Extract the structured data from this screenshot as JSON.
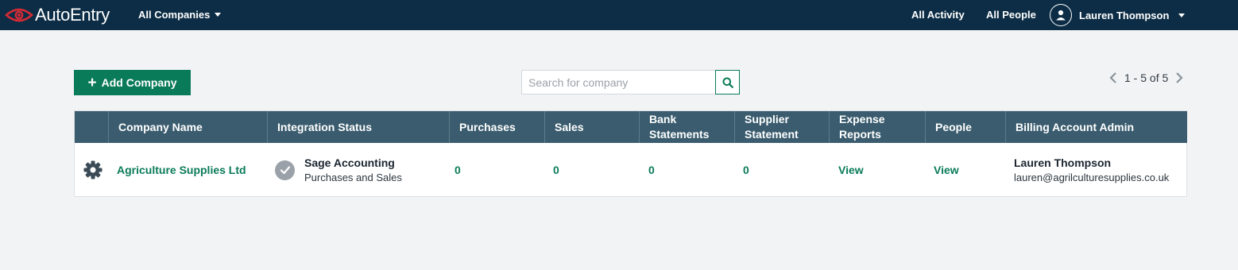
{
  "header": {
    "brand": "AutoEntry",
    "company_switch": "All Companies",
    "nav": {
      "activity": "All Activity",
      "people": "All People"
    },
    "user": {
      "name": "Lauren Thompson",
      "icon": "user-icon"
    }
  },
  "toolbar": {
    "add_company_label": "Add Company",
    "search_placeholder": "Search for company",
    "pagination": "1 - 5 of 5"
  },
  "table": {
    "columns": [
      "",
      "Company Name",
      "Integration Status",
      "Purchases",
      "Sales",
      "Bank Statements",
      "Supplier Statement",
      "Expense Reports",
      "People",
      "Billing Account Admin"
    ],
    "rows": [
      {
        "settings_icon": "gear-icon",
        "company_name": "Agriculture Supplies Ltd",
        "integration": {
          "title": "Sage Accounting",
          "subtitle": "Purchases and Sales",
          "icon": "check-circle-icon"
        },
        "purchases": "0",
        "sales": "0",
        "bank_statements": "0",
        "supplier_statement": "0",
        "expense_reports": "View",
        "people": "View",
        "billing_admin": {
          "name": "Lauren Thompson",
          "email": "lauren@agrilculturesupplies.co.uk"
        }
      }
    ]
  },
  "colors": {
    "topbar": "#0c2d45",
    "accent": "#0a7b58",
    "table_header": "#3a5c6e",
    "page_bg": "#f2f3f5",
    "logo_red": "#d42b36"
  }
}
